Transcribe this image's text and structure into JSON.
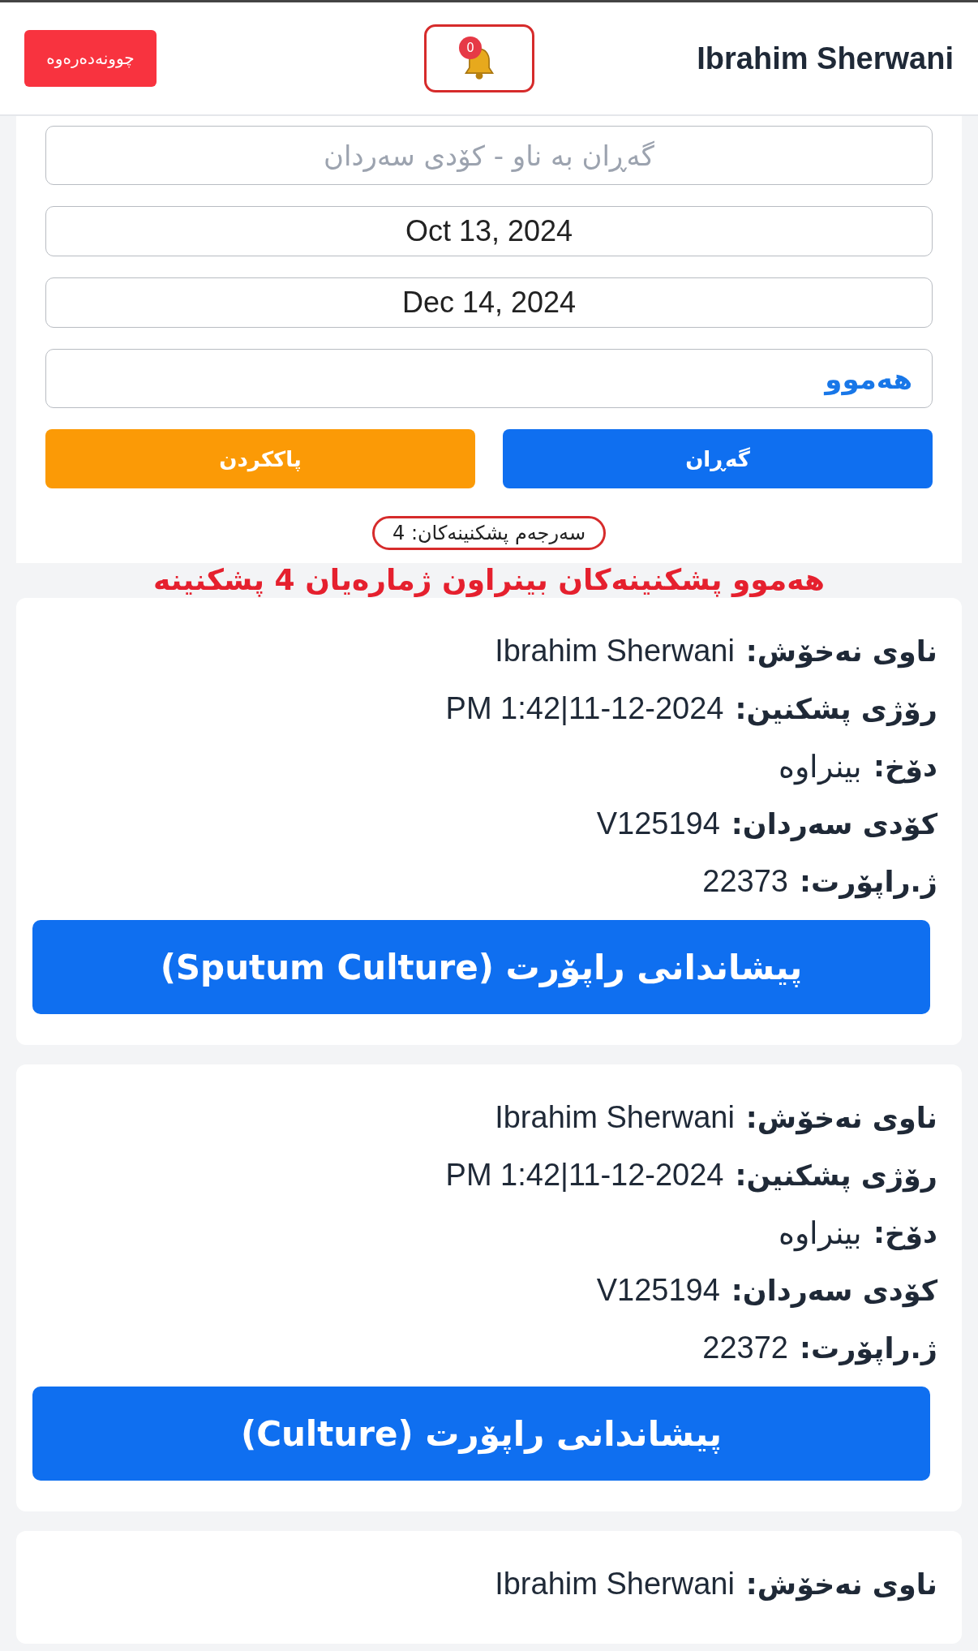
{
  "header": {
    "logout_button": "چوونەدەرەوە",
    "notifications": {
      "count": "0"
    },
    "user_name": "Ibrahim Sherwani"
  },
  "filters": {
    "search": {
      "placeholder": "گەڕان بە ناو - کۆدی سەردان"
    },
    "date_from": "Oct 13, 2024",
    "date_to": "Dec 14, 2024",
    "status": "هەموو",
    "clear_button": "پاککردن",
    "search_button": "گەڕان",
    "summary": "سەرجەم پشکنینەکان: 4"
  },
  "banner": "هەموو پشکنینەکان بینراون ژمارەیان 4 پشکنینە",
  "tests": [
    {
      "fields": [
        {
          "label": "ناوی نەخۆش:",
          "value": "Ibrahim Sherwani"
        },
        {
          "label": "رۆژی پشکنین:",
          "value": "11-12-2024|1:42 PM"
        },
        {
          "label": "دۆخ:",
          "value": "بینراوە"
        },
        {
          "label": "کۆدی سەردان:",
          "value": "V125194"
        },
        {
          "label": "ژ.راپۆرت:",
          "value": "22373"
        }
      ],
      "button": "پیشاندانی راپۆرت (Sputum Culture)"
    },
    {
      "fields": [
        {
          "label": "ناوی نەخۆش:",
          "value": "Ibrahim Sherwani"
        },
        {
          "label": "رۆژی پشکنین:",
          "value": "11-12-2024|1:42 PM"
        },
        {
          "label": "دۆخ:",
          "value": "بینراوە"
        },
        {
          "label": "کۆدی سەردان:",
          "value": "V125194"
        },
        {
          "label": "ژ.راپۆرت:",
          "value": "22372"
        }
      ],
      "button": "پیشاندانی راپۆرت (Culture)"
    },
    {
      "fields": [
        {
          "label": "ناوی نەخۆش:",
          "value": "Ibrahim Sherwani"
        }
      ]
    }
  ]
}
